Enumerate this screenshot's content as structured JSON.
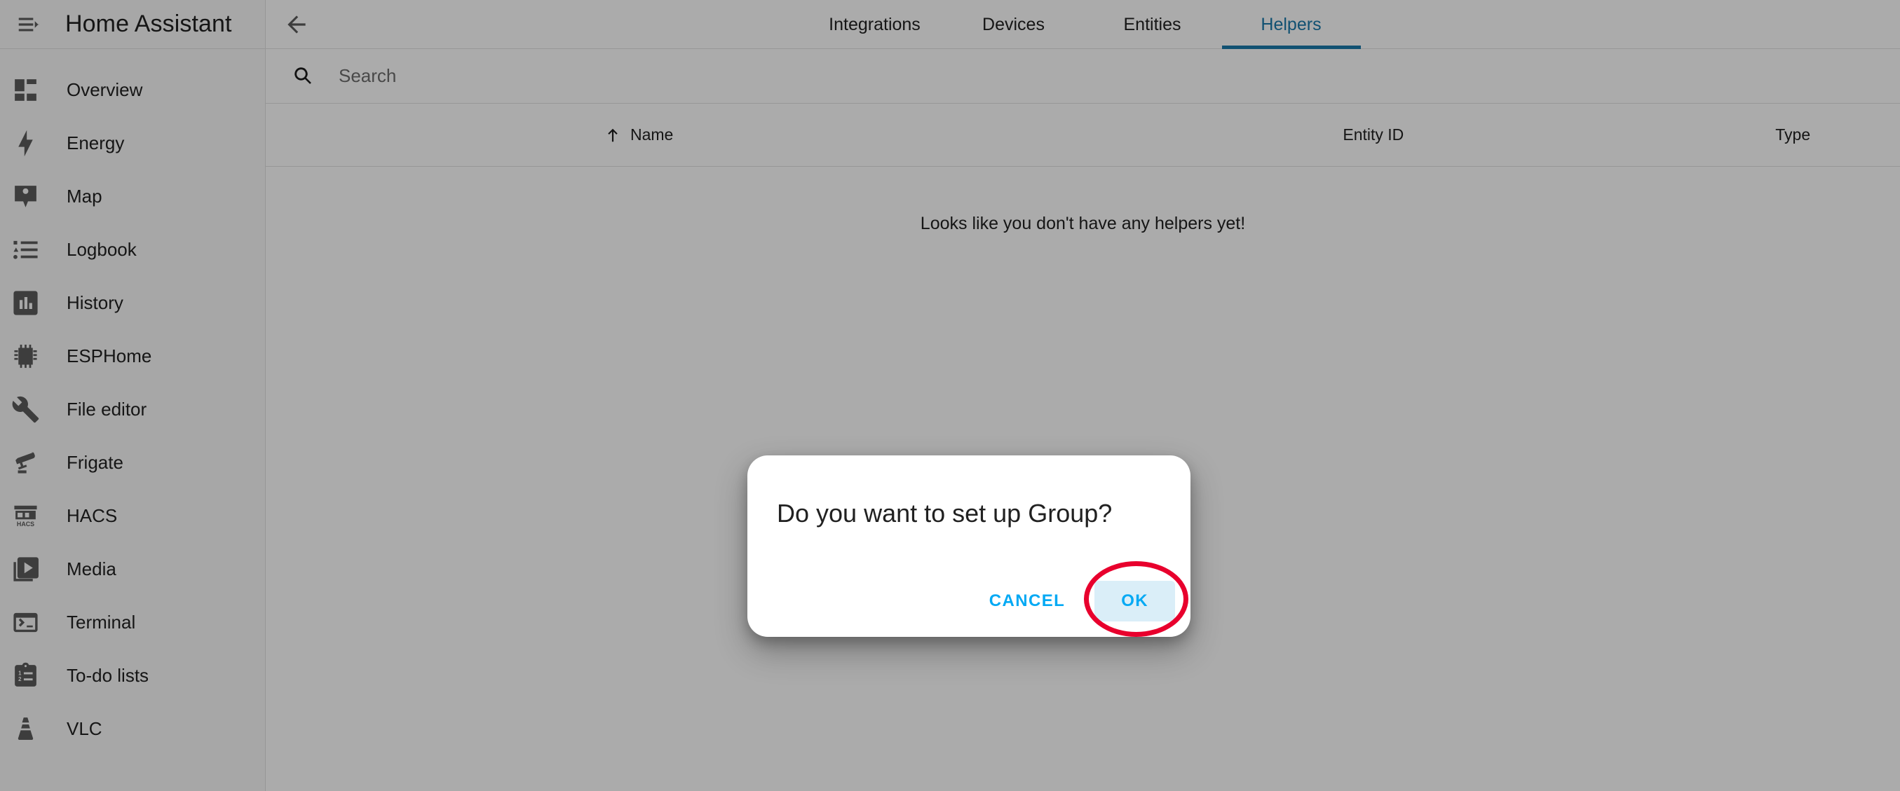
{
  "sidebar": {
    "menu_icon": "menu-open-icon",
    "title": "Home Assistant",
    "items": [
      {
        "label": "Overview",
        "icon": "view-dashboard-icon"
      },
      {
        "label": "Energy",
        "icon": "lightning-bolt-icon"
      },
      {
        "label": "Map",
        "icon": "map-marker-account-icon"
      },
      {
        "label": "Logbook",
        "icon": "format-list-bulleted-icon"
      },
      {
        "label": "History",
        "icon": "chart-box-icon"
      },
      {
        "label": "ESPHome",
        "icon": "chip-icon"
      },
      {
        "label": "File editor",
        "icon": "wrench-icon"
      },
      {
        "label": "Frigate",
        "icon": "cctv-camera-icon"
      },
      {
        "label": "HACS",
        "icon": "hacs-storefront-icon"
      },
      {
        "label": "Media",
        "icon": "play-box-multiple-icon"
      },
      {
        "label": "Terminal",
        "icon": "console-icon"
      },
      {
        "label": "To-do lists",
        "icon": "clipboard-list-icon"
      },
      {
        "label": "VLC",
        "icon": "vlc-cone-icon"
      }
    ]
  },
  "toolbar": {
    "back_icon": "arrow-left-icon",
    "tabs": [
      {
        "label": "Integrations",
        "active": false
      },
      {
        "label": "Devices",
        "active": false
      },
      {
        "label": "Entities",
        "active": false
      },
      {
        "label": "Helpers",
        "active": true
      }
    ],
    "active_tab": "Helpers",
    "accent_color": "#1a7aab"
  },
  "search": {
    "icon": "search-icon",
    "placeholder": "Search",
    "value": ""
  },
  "table": {
    "columns": [
      {
        "key": "name",
        "label": "Name",
        "sorted": "asc",
        "sort_icon": "arrow-up-icon"
      },
      {
        "key": "entity_id",
        "label": "Entity ID",
        "sorted": "none"
      },
      {
        "key": "type",
        "label": "Type",
        "sorted": "none"
      }
    ],
    "rows": [],
    "empty_message": "Looks like you don't have any helpers yet!"
  },
  "dialog": {
    "title": "Do you want to set up Group?",
    "cancel_label": "CANCEL",
    "ok_label": "OK",
    "ok_focused": true,
    "button_color": "#03a9f4",
    "ok_highlight_color": "#daeef8"
  },
  "annotation": {
    "shape": "ellipse",
    "target": "OK",
    "color": "#e8002d"
  }
}
